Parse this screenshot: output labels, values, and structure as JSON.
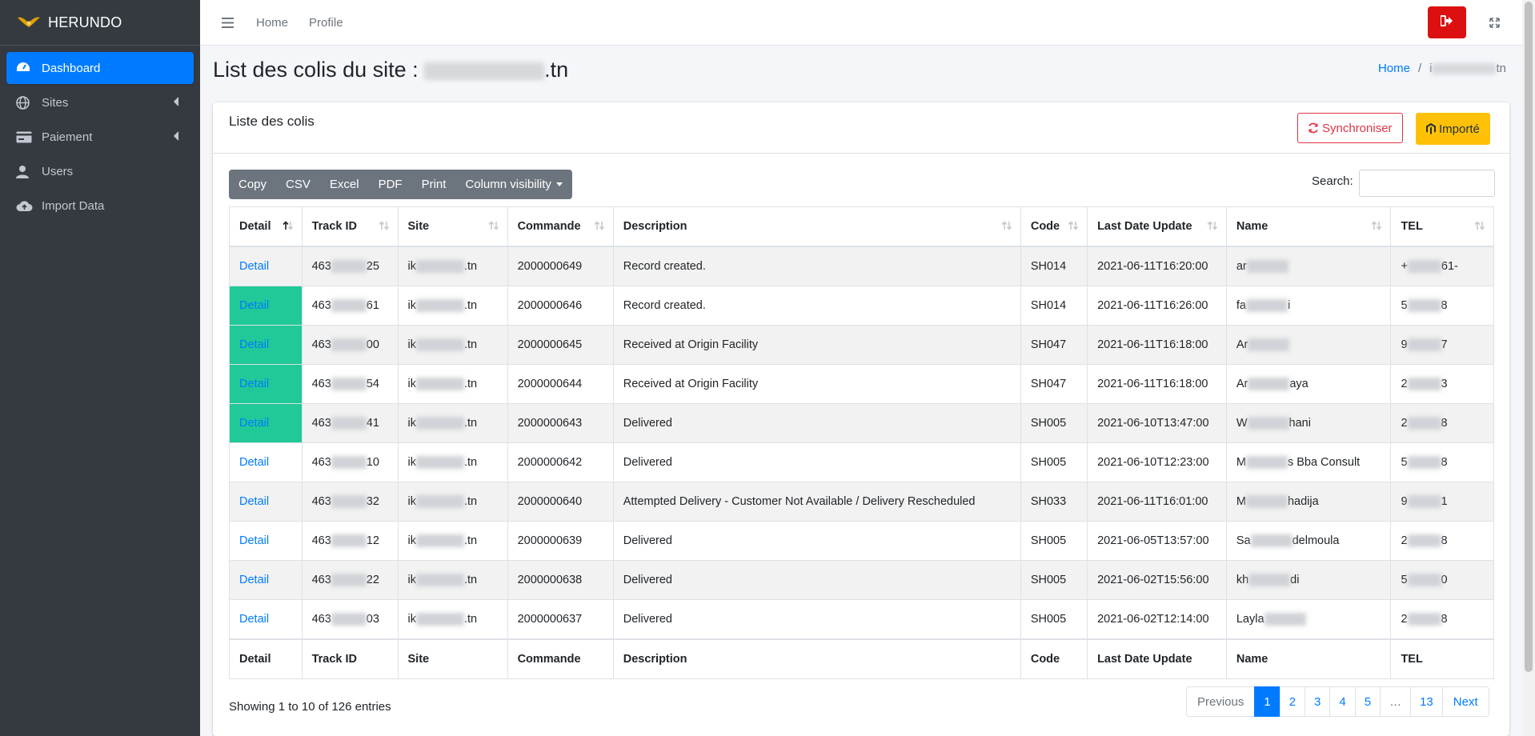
{
  "brand": {
    "name": "HERUNDO"
  },
  "sidebar": {
    "items": [
      {
        "label": "Dashboard",
        "icon": "dashboard-icon"
      },
      {
        "label": "Sites",
        "icon": "globe-icon"
      },
      {
        "label": "Paiement",
        "icon": "credit-card-icon"
      },
      {
        "label": "Users",
        "icon": "user-icon"
      },
      {
        "label": "Import Data",
        "icon": "cloud-upload-icon"
      }
    ]
  },
  "header": {
    "home_label": "Home",
    "profile_label": "Profile"
  },
  "page": {
    "title": "List des colis du site :",
    "site_suffix": ".tn",
    "breadcrumb": {
      "home": "Home",
      "current": "i",
      "current_suffix": "tn"
    }
  },
  "card": {
    "title": "Liste des colis",
    "sync_label": "Synchroniser",
    "import_label": "Importé"
  },
  "toolbar": {
    "buttons": [
      "Copy",
      "CSV",
      "Excel",
      "PDF",
      "Print"
    ],
    "column_visibility": "Column visibility",
    "search_label": "Search:"
  },
  "table": {
    "columns": [
      "Detail",
      "Track ID",
      "Site",
      "Commande",
      "Description",
      "Code",
      "Last Date Update",
      "Name",
      "TEL"
    ],
    "rows": [
      {
        "detail": "Detail",
        "track_prefix": "463",
        "track_suffix": "25",
        "site_prefix": "ik",
        "site_suffix": ".tn",
        "commande": "2000000649",
        "description": "Record created.",
        "code": "SH014",
        "date": "2021-06-11T16:20:00",
        "name_prefix": "ar",
        "name_suffix": "",
        "tel_prefix": "+",
        "tel_suffix": "61-"
      },
      {
        "detail": "Detail",
        "track_prefix": "463",
        "track_suffix": "61",
        "site_prefix": "ik",
        "site_suffix": ".tn",
        "commande": "2000000646",
        "description": "Record created.",
        "code": "SH014",
        "date": "2021-06-11T16:26:00",
        "name_prefix": "fa",
        "name_suffix": "i",
        "tel_prefix": "5",
        "tel_suffix": "8"
      },
      {
        "detail": "Detail",
        "track_prefix": "463",
        "track_suffix": "00",
        "site_prefix": "ik",
        "site_suffix": ".tn",
        "commande": "2000000645",
        "description": "Received at Origin Facility",
        "code": "SH047",
        "date": "2021-06-11T16:18:00",
        "name_prefix": "Ar",
        "name_suffix": "",
        "tel_prefix": "9",
        "tel_suffix": "7"
      },
      {
        "detail": "Detail",
        "track_prefix": "463",
        "track_suffix": "54",
        "site_prefix": "ik",
        "site_suffix": ".tn",
        "commande": "2000000644",
        "description": "Received at Origin Facility",
        "code": "SH047",
        "date": "2021-06-11T16:18:00",
        "name_prefix": "Ar",
        "name_suffix": "aya",
        "tel_prefix": "2",
        "tel_suffix": "3"
      },
      {
        "detail": "Detail",
        "track_prefix": "463",
        "track_suffix": "41",
        "site_prefix": "ik",
        "site_suffix": ".tn",
        "commande": "2000000643",
        "description": "Delivered",
        "code": "SH005",
        "date": "2021-06-10T13:47:00",
        "name_prefix": "W",
        "name_suffix": "hani",
        "tel_prefix": "2",
        "tel_suffix": "8"
      },
      {
        "detail": "Detail",
        "track_prefix": "463",
        "track_suffix": "10",
        "site_prefix": "ik",
        "site_suffix": ".tn",
        "commande": "2000000642",
        "description": "Delivered",
        "code": "SH005",
        "date": "2021-06-10T12:23:00",
        "name_prefix": "M",
        "name_suffix": "s Bba Consult",
        "tel_prefix": "5",
        "tel_suffix": "8"
      },
      {
        "detail": "Detail",
        "track_prefix": "463",
        "track_suffix": "32",
        "site_prefix": "ik",
        "site_suffix": ".tn",
        "commande": "2000000640",
        "description": "Attempted Delivery - Customer Not Available / Delivery Rescheduled",
        "code": "SH033",
        "date": "2021-06-11T16:01:00",
        "name_prefix": "M",
        "name_suffix": "hadija",
        "tel_prefix": "9",
        "tel_suffix": "1"
      },
      {
        "detail": "Detail",
        "track_prefix": "463",
        "track_suffix": "12",
        "site_prefix": "ik",
        "site_suffix": ".tn",
        "commande": "2000000639",
        "description": "Delivered",
        "code": "SH005",
        "date": "2021-06-05T13:57:00",
        "name_prefix": "Sa",
        "name_suffix": "delmoula",
        "tel_prefix": "2",
        "tel_suffix": "8"
      },
      {
        "detail": "Detail",
        "track_prefix": "463",
        "track_suffix": "22",
        "site_prefix": "ik",
        "site_suffix": ".tn",
        "commande": "2000000638",
        "description": "Delivered",
        "code": "SH005",
        "date": "2021-06-02T15:56:00",
        "name_prefix": "kh",
        "name_suffix": "di",
        "tel_prefix": "5",
        "tel_suffix": "0"
      },
      {
        "detail": "Detail",
        "track_prefix": "463",
        "track_suffix": "03",
        "site_prefix": "ik",
        "site_suffix": ".tn",
        "commande": "2000000637",
        "description": "Delivered",
        "code": "SH005",
        "date": "2021-06-02T12:14:00",
        "name_prefix": "Layla",
        "name_suffix": "",
        "tel_prefix": "2",
        "tel_suffix": "8"
      }
    ]
  },
  "footer": {
    "info": "Showing 1 to 10 of 126 entries",
    "pages": [
      "Previous",
      "1",
      "2",
      "3",
      "4",
      "5",
      "…",
      "13",
      "Next"
    ]
  },
  "colors": {
    "sidebar_bg": "#343a40",
    "active_blue": "#007bff",
    "logout_red": "#dc1010",
    "import_yellow": "#ffc107",
    "highlight_teal": "#20c997"
  }
}
